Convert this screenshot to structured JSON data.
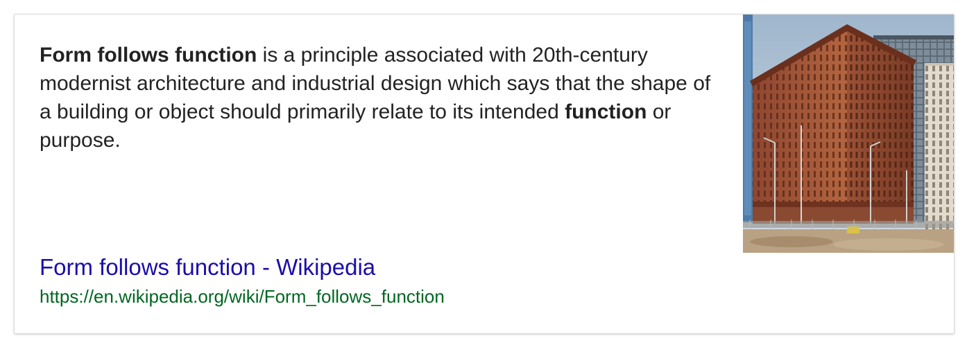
{
  "snippet": {
    "term": "Form follows function",
    "text_1": " is a principle associated with 20th-century modernist architecture and industrial design which says that the shape of a building or object should primarily relate to its intended ",
    "emphasis": "function",
    "text_2": " or purpose."
  },
  "result": {
    "title": "Form follows function - Wikipedia",
    "url": "https://en.wikipedia.org/wiki/Form_follows_function"
  },
  "image": {
    "subject": "building-photo",
    "colors": {
      "sky": "#b8c9d8",
      "brick": "#a85a3c",
      "brick_dark": "#7d3f27",
      "ground": "#b79f82"
    }
  },
  "colors": {
    "text": "#222222",
    "link": "#1a0dab",
    "url": "#006621",
    "border": "#dcdcdc"
  }
}
